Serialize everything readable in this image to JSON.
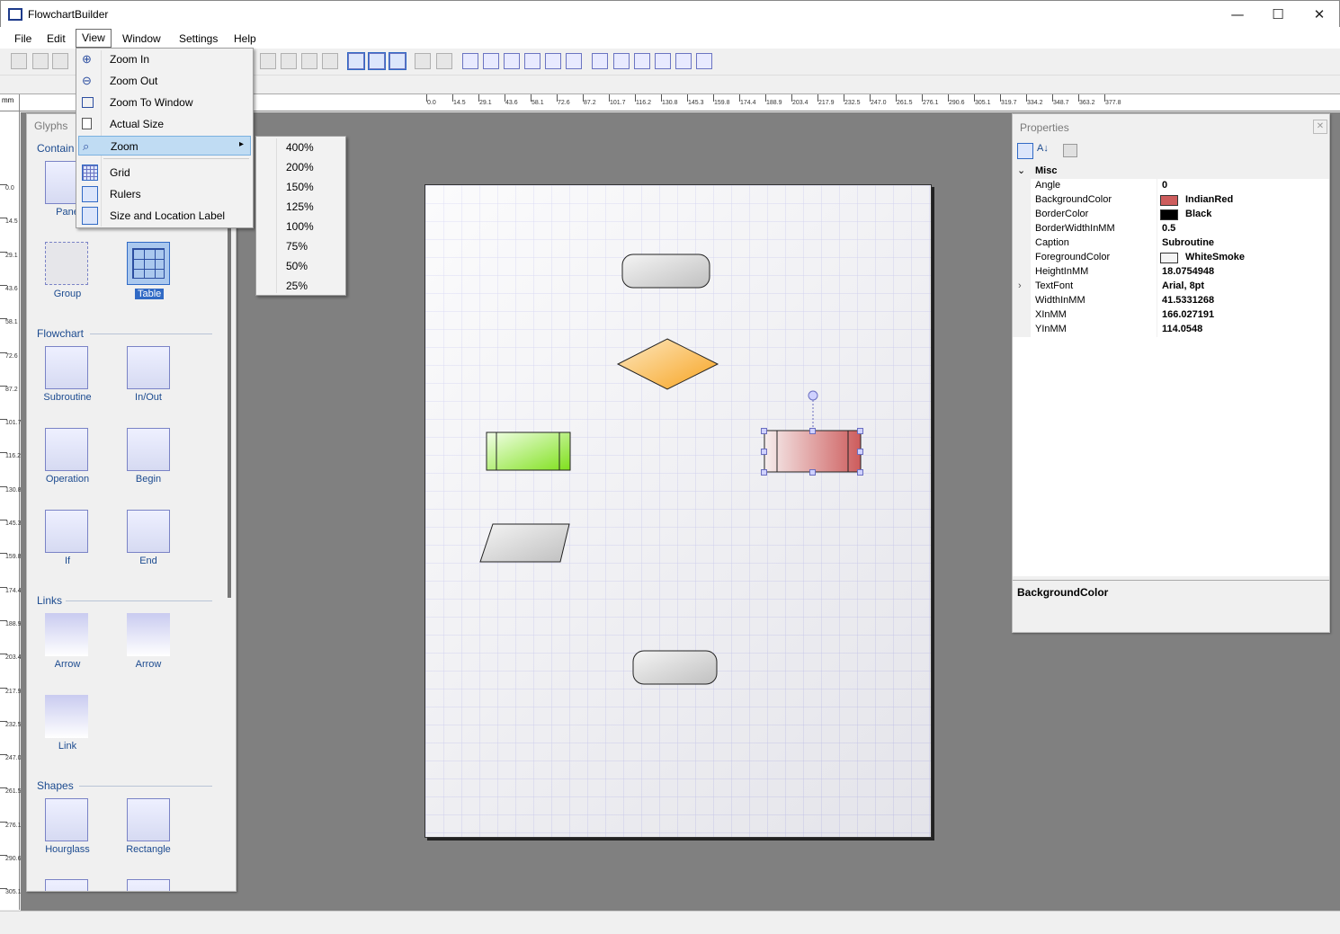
{
  "window": {
    "title": "FlowchartBuilder",
    "controls": [
      "—",
      "☐",
      "✕"
    ]
  },
  "menubar": [
    "File",
    "Edit",
    "View",
    "Window",
    "Settings",
    "Help"
  ],
  "view_menu": {
    "items": [
      {
        "label": "Zoom In",
        "icon": "zoom-in-icon"
      },
      {
        "label": "Zoom Out",
        "icon": "zoom-out-icon"
      },
      {
        "label": "Zoom To Window",
        "icon": "zoom-window-icon"
      },
      {
        "label": "Actual Size",
        "icon": "actual-size-icon"
      },
      {
        "label": "Zoom",
        "icon": "zoom-icon",
        "submenu": "▸"
      },
      {
        "label": "Grid",
        "icon": "grid-icon"
      },
      {
        "label": "Rulers",
        "icon": "rulers-icon"
      },
      {
        "label": "Size and Location Label",
        "icon": "size-label-icon"
      }
    ]
  },
  "zoom_menu": [
    "400%",
    "200%",
    "150%",
    "125%",
    "100%",
    "75%",
    "50%",
    "25%"
  ],
  "rulers": {
    "unit": "mm",
    "horizontal": [
      "0.0",
      "14.5",
      "29.1",
      "43.6",
      "58.1",
      "72.6",
      "87.2",
      "101.7",
      "116.2",
      "130.8",
      "145.3",
      "159.8",
      "174.4",
      "188.9",
      "203.4",
      "217.9",
      "232.5",
      "247.0",
      "261.5",
      "276.1",
      "290.6",
      "305.1",
      "319.7",
      "334.2",
      "348.7",
      "363.2",
      "377.8"
    ],
    "vertical": [
      "0.0",
      "14.5",
      "29.1",
      "43.6",
      "58.1",
      "72.6",
      "87.2",
      "101.7",
      "116.2",
      "130.8",
      "145.3",
      "159.8",
      "174.4",
      "188.9",
      "203.4",
      "217.9",
      "232.5",
      "247.0",
      "261.5",
      "276.1",
      "290.6",
      "305.1"
    ]
  },
  "glyphs": {
    "title": "Glyphs",
    "sections": {
      "containers": "Contain",
      "flowchart": "Flowchart",
      "links": "Links",
      "shapes": "Shapes"
    },
    "items": {
      "panel": "Pane",
      "group": "Group",
      "table": "Table",
      "subroutine": "Subroutine",
      "inout": "In/Out",
      "operation": "Operation",
      "begin": "Begin",
      "if": "If",
      "end": "End",
      "arrow1": "Arrow",
      "arrow2": "Arrow",
      "link": "Link",
      "hourglass": "Hourglass",
      "rectangle": "Rectangle"
    }
  },
  "properties": {
    "title": "Properties",
    "category": "Misc",
    "rows": [
      {
        "name": "Angle",
        "value": "0"
      },
      {
        "name": "BackgroundColor",
        "value": "IndianRed",
        "swatch": "#cd5c5c"
      },
      {
        "name": "BorderColor",
        "value": "Black",
        "swatch": "#000000"
      },
      {
        "name": "BorderWidthInMM",
        "value": "0.5"
      },
      {
        "name": "Caption",
        "value": "Subroutine"
      },
      {
        "name": "ForegroundColor",
        "value": "WhiteSmoke",
        "swatch": "#f5f5f5"
      },
      {
        "name": "HeightInMM",
        "value": "18.0754948"
      },
      {
        "name": "TextFont",
        "value": "Arial, 8pt",
        "expandable": true
      },
      {
        "name": "WidthInMM",
        "value": "41.5331268"
      },
      {
        "name": "XInMM",
        "value": "166.027191"
      },
      {
        "name": "YInMM",
        "value": "114.0548"
      }
    ],
    "description_title": "BackgroundColor"
  }
}
